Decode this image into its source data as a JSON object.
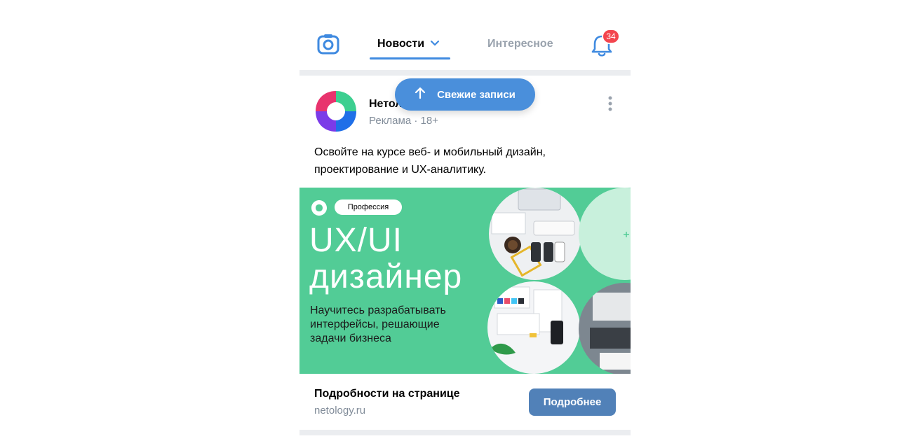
{
  "header": {
    "tabs": [
      {
        "label": "Новости",
        "active": true
      },
      {
        "label": "Интересное",
        "active": false
      }
    ],
    "notifications_count": "34"
  },
  "fresh_posts_button": {
    "label": "Свежие записи",
    "icon": "arrow-up-icon"
  },
  "post": {
    "author": "Нетология",
    "meta": "Реклама · 18+",
    "text": "Освойте на курсе веб- и мобильный дизайн, проектирование и UX-аналитику.",
    "banner": {
      "tag": "Профессия",
      "title_line1": "UX/UI",
      "title_line2": "дизайнер",
      "subtitle": "Научитесь разрабатывать интерфейсы, решающие задачи бизнеса",
      "background_color": "#52cc96"
    },
    "footer": {
      "title": "Подробности на странице",
      "domain": "netology.ru",
      "action_label": "Подробнее"
    }
  },
  "colors": {
    "accent": "#3f8ae0",
    "button": "#5181b8",
    "badge": "#f3454e"
  }
}
